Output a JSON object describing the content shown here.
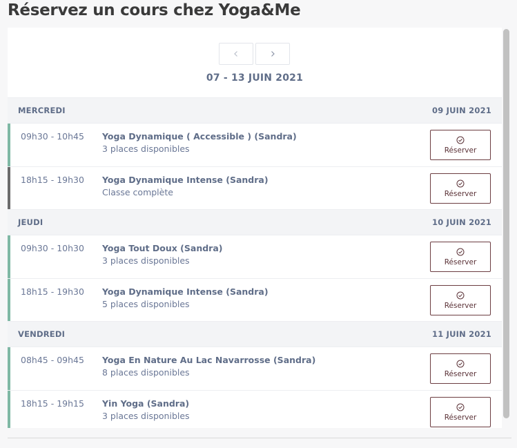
{
  "page": {
    "title": "Réservez un cours chez Yoga&Me"
  },
  "calendar": {
    "week_label": "07 - 13 JUIN 2021",
    "prev_icon": "chevron-left-icon",
    "next_icon": "chevron-right-icon"
  },
  "colors": {
    "available_bar": "#7fb8a4",
    "full_bar": "#6b6b6b",
    "button_border": "#6b3c40"
  },
  "days": [
    {
      "day": "MERCREDI",
      "date": "09 JUIN 2021",
      "sessions": [
        {
          "time": "09h30 - 10h45",
          "title": "Yoga Dynamique ( Accessible ) (Sandra)",
          "status": "3 places disponibles",
          "full": false,
          "button": "Réserver"
        },
        {
          "time": "18h15 - 19h30",
          "title": "Yoga Dynamique Intense (Sandra)",
          "status": "Classe complète",
          "full": true,
          "button": "Réserver"
        }
      ]
    },
    {
      "day": "JEUDI",
      "date": "10 JUIN 2021",
      "sessions": [
        {
          "time": "09h30 - 10h30",
          "title": "Yoga Tout Doux (Sandra)",
          "status": "3 places disponibles",
          "full": false,
          "button": "Réserver"
        },
        {
          "time": "18h15 - 19h30",
          "title": "Yoga Dynamique Intense (Sandra)",
          "status": "5 places disponibles",
          "full": false,
          "button": "Réserver"
        }
      ]
    },
    {
      "day": "VENDREDI",
      "date": "11 JUIN 2021",
      "sessions": [
        {
          "time": "08h45 - 09h45",
          "title": "Yoga En Nature Au Lac Navarrosse (Sandra)",
          "status": "8 places disponibles",
          "full": false,
          "button": "Réserver"
        },
        {
          "time": "18h15 - 19h15",
          "title": "Yin Yoga (Sandra)",
          "status": "3 places disponibles",
          "full": false,
          "button": "Réserver"
        }
      ]
    }
  ]
}
